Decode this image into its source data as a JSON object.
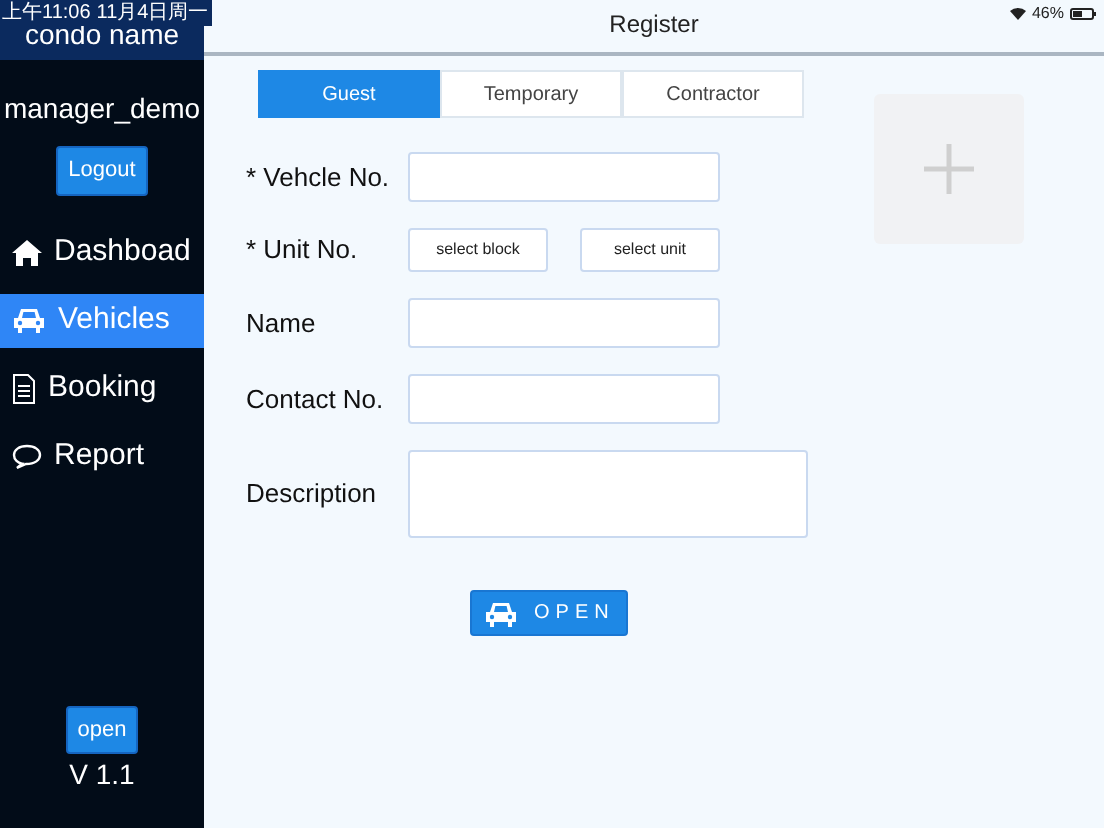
{
  "status_bar": {
    "time": "上午11:06",
    "date": "11月4日周一",
    "battery": "46%"
  },
  "sidebar": {
    "title": "condo name",
    "user": "manager_demo",
    "logout": "Logout",
    "items": [
      {
        "label": "Dashboad",
        "selected": false
      },
      {
        "label": "Vehicles",
        "selected": true
      },
      {
        "label": "Booking",
        "selected": false
      },
      {
        "label": "Report",
        "selected": false
      }
    ],
    "footer_button": "open",
    "version": "V 1.1"
  },
  "header": {
    "title": "Register"
  },
  "tabs": [
    {
      "label": "Guest",
      "selected": true
    },
    {
      "label": "Temporary",
      "selected": false
    },
    {
      "label": "Contractor",
      "selected": false
    }
  ],
  "fields": [
    {
      "kind": "text",
      "label": "* Vehcle No."
    },
    {
      "kind": "select_pair",
      "label": "* Unit No.",
      "buttons": [
        "select block",
        "select unit"
      ]
    },
    {
      "kind": "text",
      "label": "Name"
    },
    {
      "kind": "text",
      "label": "Contact No."
    },
    {
      "kind": "textarea",
      "label": "Description"
    }
  ],
  "open_button": "OPEN"
}
